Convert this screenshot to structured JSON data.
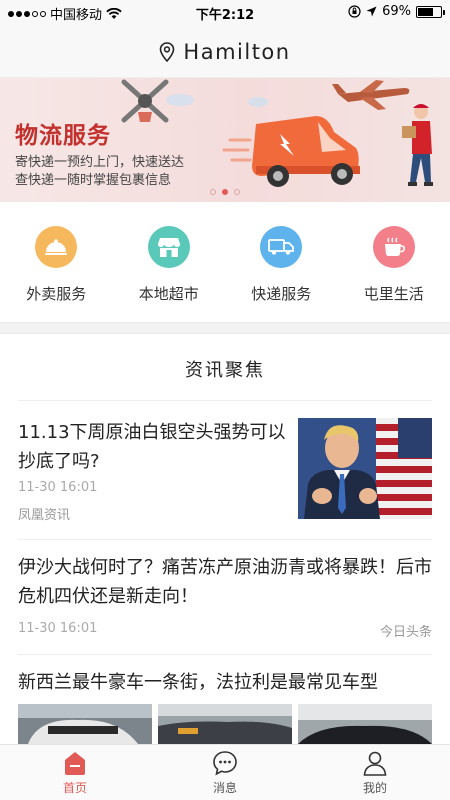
{
  "status_bar": {
    "carrier": "中国移动",
    "time": "下午2:12",
    "battery": "69%",
    "battery_level": 0.69
  },
  "header": {
    "title": "Hamilton",
    "icon": "location-pin-icon"
  },
  "banner": {
    "title": "物流服务",
    "line1": "寄快递一预约上门，快速送达",
    "line2": "查快递一随时掌握包裹信息",
    "slide_count": 3,
    "active_slide": 2
  },
  "services": [
    {
      "label": "外卖服务",
      "icon": "food-cloche-icon",
      "color": "#f5b85c"
    },
    {
      "label": "本地超市",
      "icon": "store-icon",
      "color": "#5bc9b9"
    },
    {
      "label": "快递服务",
      "icon": "truck-icon",
      "color": "#5fb3ec"
    },
    {
      "label": "屯里生活",
      "icon": "coffee-cup-icon",
      "color": "#f27f8a"
    }
  ],
  "news_section": {
    "title": "资讯聚焦",
    "items": [
      {
        "title": "11.13下周原油白银空头强势可以抄底了吗?",
        "time": "11-30 16:01",
        "source": "凤凰资讯"
      },
      {
        "title": "伊沙大战何时了？痛苦冻产原油沥青或将暴跌！后市危机四伏还是新走向！",
        "time": "11-30 16:01",
        "source": "今日头条"
      },
      {
        "title": "新西兰最牛豪车一条街，法拉利是最常见车型"
      }
    ]
  },
  "tabbar": {
    "tabs": [
      {
        "label": "首页",
        "icon": "home-icon"
      },
      {
        "label": "消息",
        "icon": "chat-bubble-icon"
      },
      {
        "label": "我的",
        "icon": "user-icon"
      }
    ]
  },
  "colors": {
    "accent": "#e25a55",
    "banner_title": "#c2312d"
  }
}
